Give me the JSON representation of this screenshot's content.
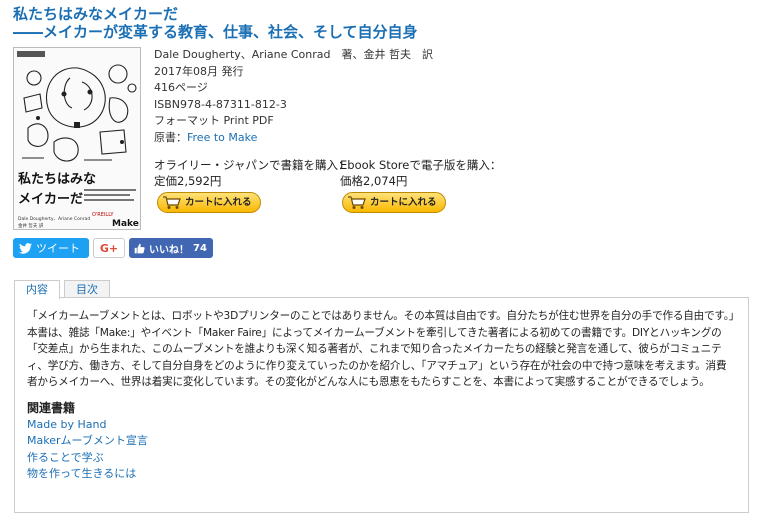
{
  "title": {
    "line1": "私たちはみなメイカーだ",
    "line2": "――メイカーが変革する教育、仕事、社会、そして自分自身"
  },
  "book": {
    "authors": "Dale Dougherty、Ariane Conrad　著、金井 哲夫　訳",
    "date": "2017年08月 発行",
    "pages": "416ページ",
    "isbn": "ISBN978-4-87311-812-3",
    "format": "フォーマット Print PDF",
    "original_label": "原書：",
    "original_link": "Free to Make"
  },
  "cover": {
    "title_line1": "私たちはみな",
    "title_line2": "メイカーだ",
    "authors_small": "Dale Dougherty、Ariane Conrad",
    "translator_small": "金井 哲夫 訳",
    "publisher_logo": "O'REILLY",
    "make_logo": "Make:"
  },
  "purchase": {
    "print_label": "オライリー・ジャパンで書籍を購入：",
    "print_price": "定価2,592円",
    "ebook_label": "Ebook Storeで電子版を購入：",
    "ebook_price": "価格2,074円",
    "cart_label": "カートに入れる"
  },
  "social": {
    "tweet": "ツイート",
    "gplus": "G+",
    "like": "いいね！",
    "like_count": "74"
  },
  "tabs": [
    {
      "label": "内容"
    },
    {
      "label": "目次"
    }
  ],
  "description": "「メイカームーブメントとは、ロボットや3Dプリンターのことではありません。その本質は自由です。自分たちが住む世界を自分の手で作る自由です。」本書は、雑誌「Make:」やイベント「Maker Faire」によってメイカームーブメントを牽引してきた著者による初めての書籍です。DIYとハッキングの「交差点」から生まれた、このムーブメントを誰よりも深く知る著者が、これまで知り合ったメイカーたちの経験と発言を通して、彼らがコミュニティ、学び方、働き方、そして自分自身をどのように作り変えていったのかを紹介し、「アマチュア」という存在が社会の中で持つ意味を考えます。消費者からメイカーへ、世界は着実に変化しています。その変化がどんな人にも恩恵をもたらすことを、本書によって実感することができるでしょう。",
  "related": {
    "heading": "関連書籍",
    "items": [
      {
        "label": "Made by Hand"
      },
      {
        "label": "Makerムーブメント宣言"
      },
      {
        "label": "作ることで学ぶ"
      },
      {
        "label": "物を作って生きるには"
      }
    ]
  },
  "colors": {
    "link": "#1b6fb4",
    "twitter": "#1da1f2",
    "facebook": "#4267b2",
    "cart": "#f9b800"
  }
}
